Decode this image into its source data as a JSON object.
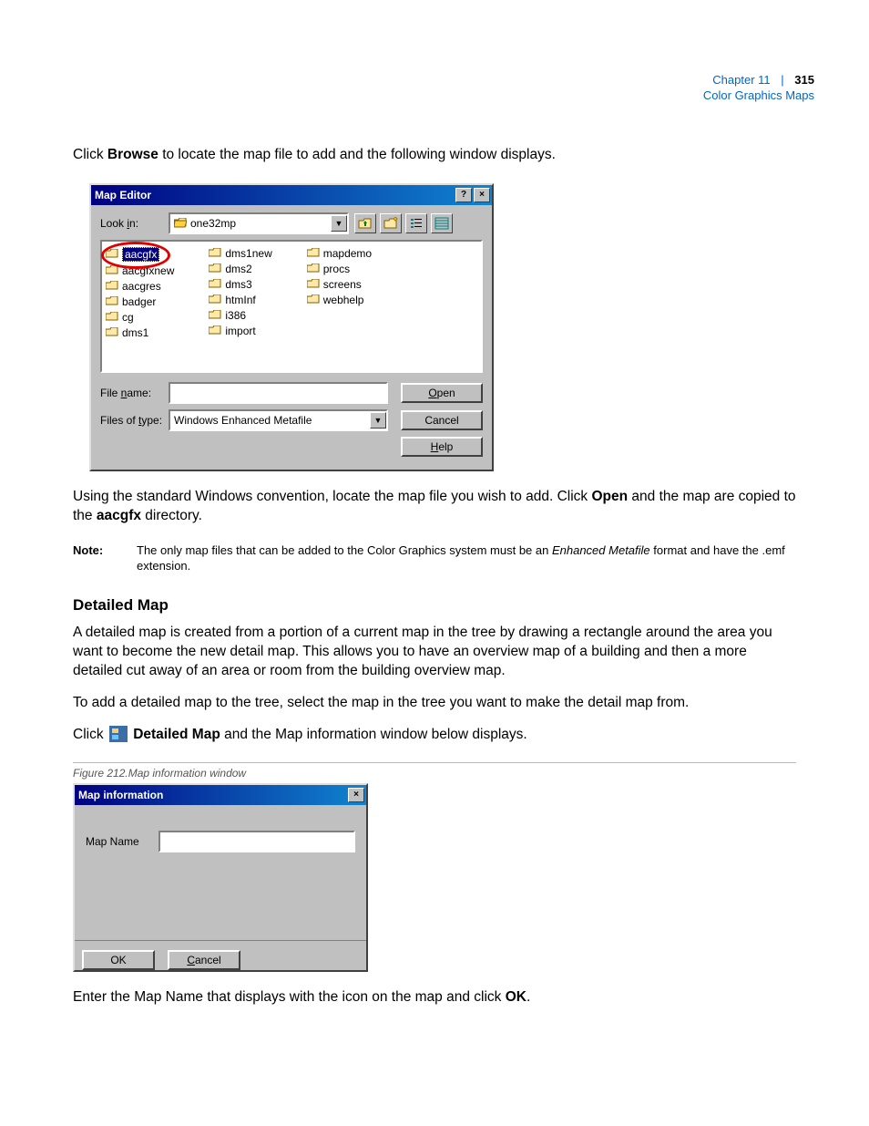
{
  "header": {
    "chapter": "Chapter 11",
    "section": "Color Graphics Maps",
    "page_number": "315"
  },
  "para1_a": "Click ",
  "para1_b": "Browse",
  "para1_c": " to locate the map file to add and the following window displays.",
  "dialog1": {
    "title": "Map Editor",
    "lookin_label": "Look in:",
    "lookin_value": "one32mp",
    "file_name_label": "File name:",
    "file_name_value": "",
    "file_type_label": "Files of type:",
    "file_type_value": "Windows Enhanced Metafile",
    "open_btn": "Open",
    "cancel_btn": "Cancel",
    "help_btn": "Help",
    "col1": [
      "aacgfx",
      "aacgfxnew",
      "aacgres",
      "badger",
      "cg",
      "dms1"
    ],
    "col2": [
      "dms1new",
      "dms2",
      "dms3",
      "htmInf",
      "i386",
      "import"
    ],
    "col3": [
      "mapdemo",
      "procs",
      "screens",
      "webhelp"
    ]
  },
  "para2_a": "Using the standard Windows convention, locate the map file you wish to add. Click ",
  "para2_b": "Open",
  "para2_c": " and the map are copied to the ",
  "para2_d": "aacgfx",
  "para2_e": " directory.",
  "note": {
    "label": "Note:",
    "text_a": "The only map files that can be added to the Color Graphics system must be an ",
    "text_i": "Enhanced Metafile",
    "text_b": " format and have the .emf extension."
  },
  "heading": "Detailed Map",
  "para3": "A detailed map is created from a portion of a current map in the tree by drawing a rectangle around the area you want to become the new detail map. This allows you to have an overview map of a building and then a more detailed cut away of an area or room from the building overview map.",
  "para4": "To add a detailed map to the tree, select the map in the tree you want to make the detail map from.",
  "para5_a": "Click ",
  "para5_b": "Detailed Map",
  "para5_c": " and the Map information window below displays.",
  "figcap": "Figure 212.Map information window",
  "dialog2": {
    "title": "Map information",
    "mapname_label": "Map Name",
    "mapname_value": "",
    "ok_btn": "OK",
    "cancel_btn": "Cancel"
  },
  "para6_a": "Enter the Map Name that displays with the icon on the map and click ",
  "para6_b": "OK",
  "para6_c": "."
}
